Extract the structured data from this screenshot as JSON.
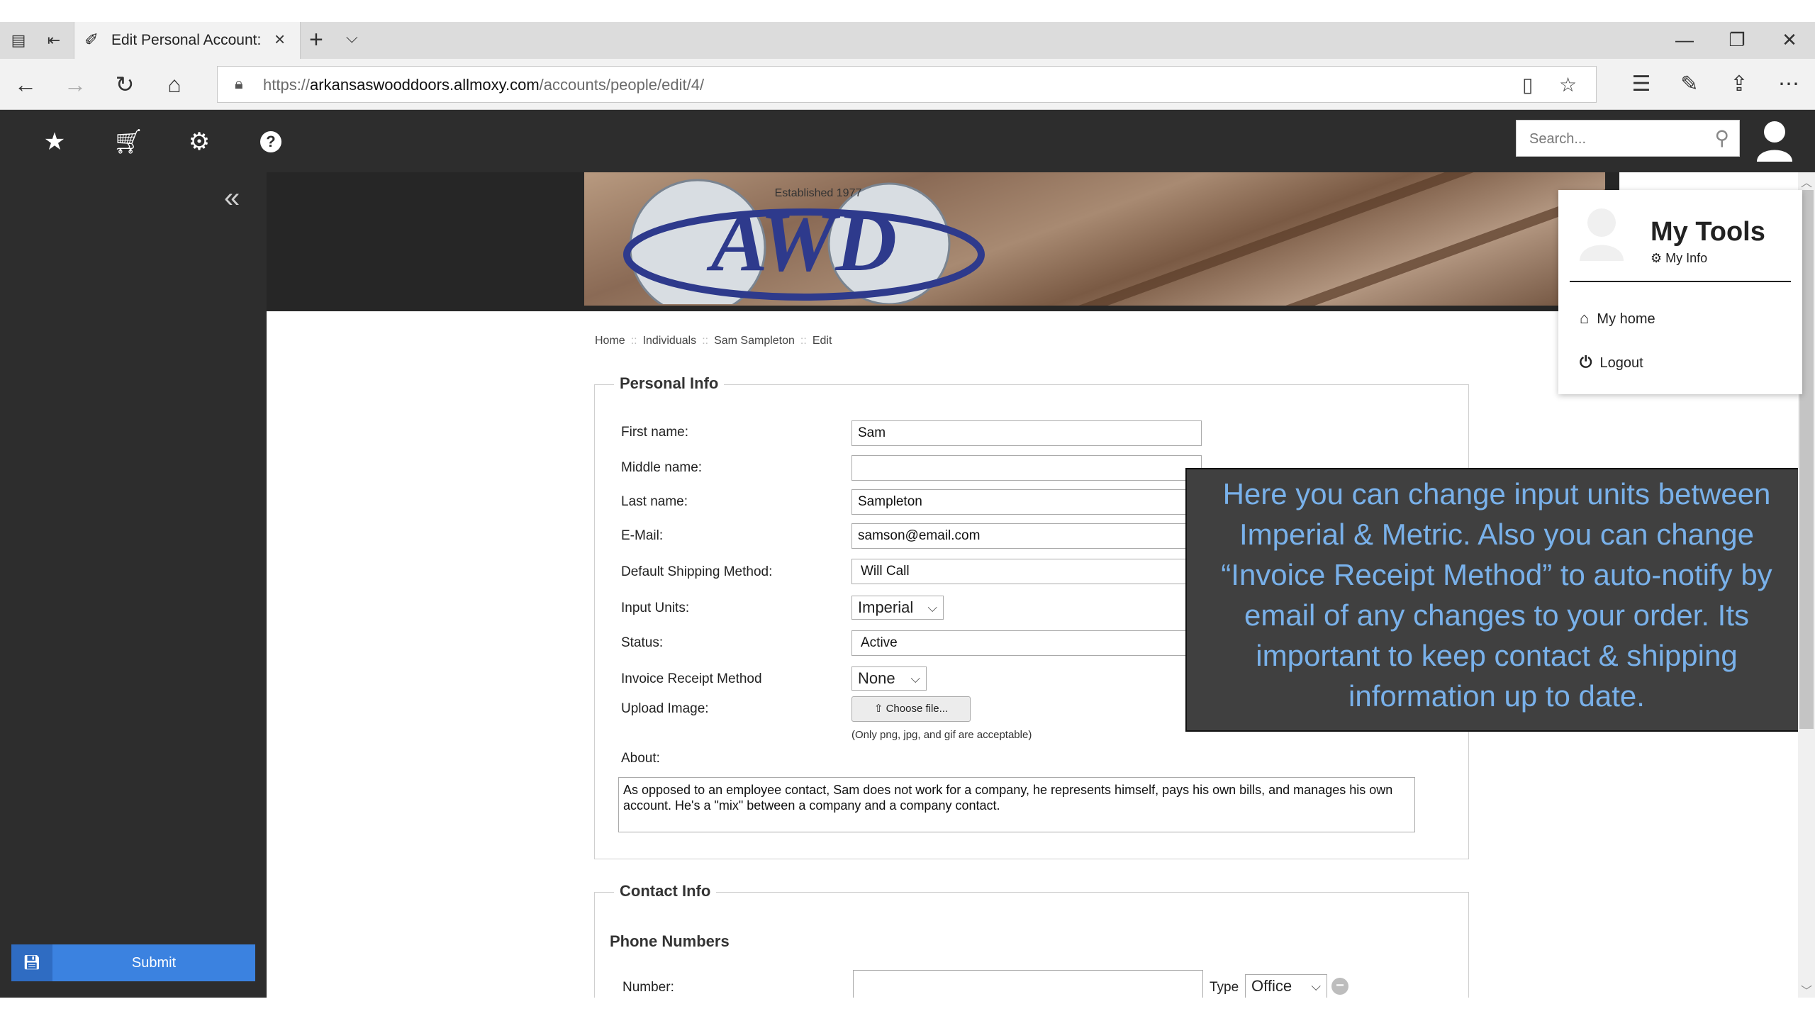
{
  "browser": {
    "tab_title": "Edit Personal Account: S",
    "url_protocol": "https://",
    "url_domain": "arkansaswooddoors.allmoxy.com",
    "url_path": "/accounts/people/edit/4/"
  },
  "app": {
    "search_placeholder": "Search...",
    "submit_label": "Submit",
    "banner_tagline": "Established 1977",
    "banner_logo": "AWD"
  },
  "breadcrumb": [
    "Home",
    "Individuals",
    "Sam Sampleton",
    "Edit"
  ],
  "personal_info": {
    "legend": "Personal Info",
    "first_name_label": "First name:",
    "first_name_value": "Sam",
    "middle_name_label": "Middle name:",
    "middle_name_value": "",
    "last_name_label": "Last name:",
    "last_name_value": "Sampleton",
    "email_label": "E-Mail:",
    "email_value": "samson@email.com",
    "shipping_label": "Default Shipping Method:",
    "shipping_value": "Will Call",
    "units_label": "Input Units:",
    "units_value": "Imperial",
    "status_label": "Status:",
    "status_value": "Active",
    "invoice_label": "Invoice Receipt Method",
    "invoice_value": "None",
    "upload_label": "Upload Image:",
    "upload_button": "Choose file...",
    "upload_hint": "(Only png, jpg, and gif are acceptable)",
    "about_label": "About:",
    "about_value": "As opposed to an employee contact, Sam does not work for a company, he represents himself, pays his own bills, and manages his own account. He's a \"mix\" between a company and a company contact."
  },
  "contact_info": {
    "legend": "Contact Info",
    "phone_heading": "Phone Numbers",
    "number_label": "Number:",
    "type_label": "Type",
    "type_value": "Office"
  },
  "tooltip": {
    "text": "Here you can change input units between Imperial & Metric. Also you can change “Invoice Receipt Method” to auto-notify by email of any changes to your order. Its important to keep contact & shipping information up to date."
  },
  "dropdown": {
    "title": "My Tools",
    "my_info": "My Info",
    "items": [
      "My home",
      "Logout"
    ]
  }
}
